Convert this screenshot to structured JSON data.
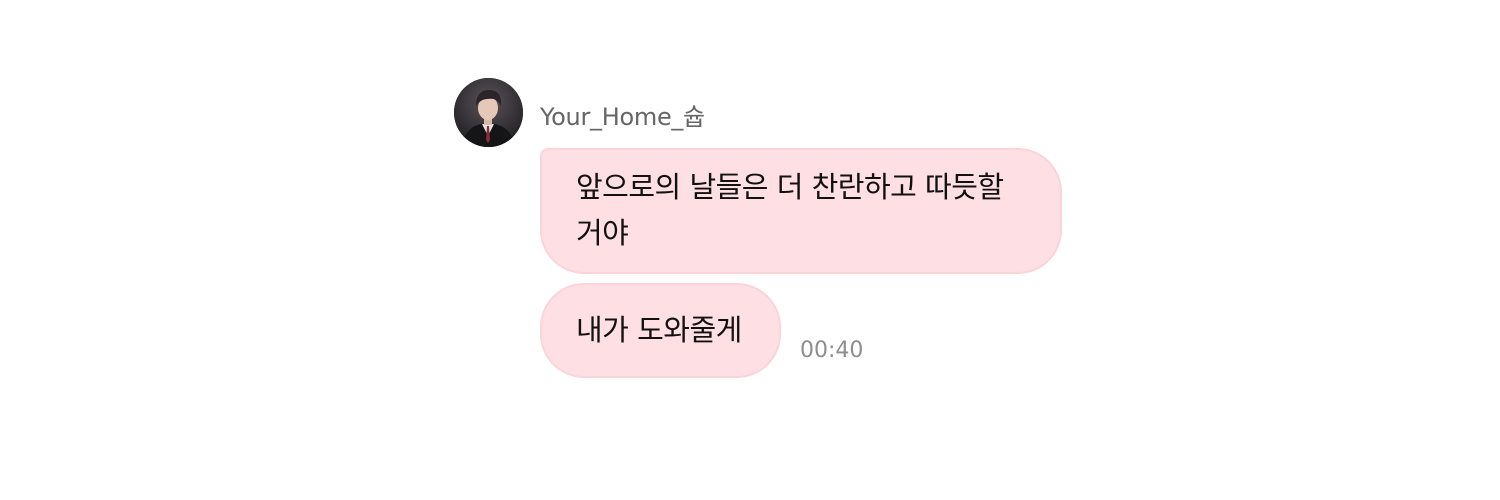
{
  "chat": {
    "sender": {
      "name": "Your_Home_슙"
    },
    "messages": [
      {
        "text": "앞으로의 날들은 더 찬란하고 따듯할 거야"
      },
      {
        "text": "내가 도와줄게"
      }
    ],
    "timestamp": "00:40"
  },
  "colors": {
    "bubble_background": "#fedfe4",
    "bubble_border": "#fbd4da",
    "name_text": "#666666",
    "message_text": "#111111",
    "timestamp_text": "#8e8e8e",
    "page_background": "#ffffff"
  },
  "icons": {
    "avatar": "profile-photo-avatar"
  }
}
